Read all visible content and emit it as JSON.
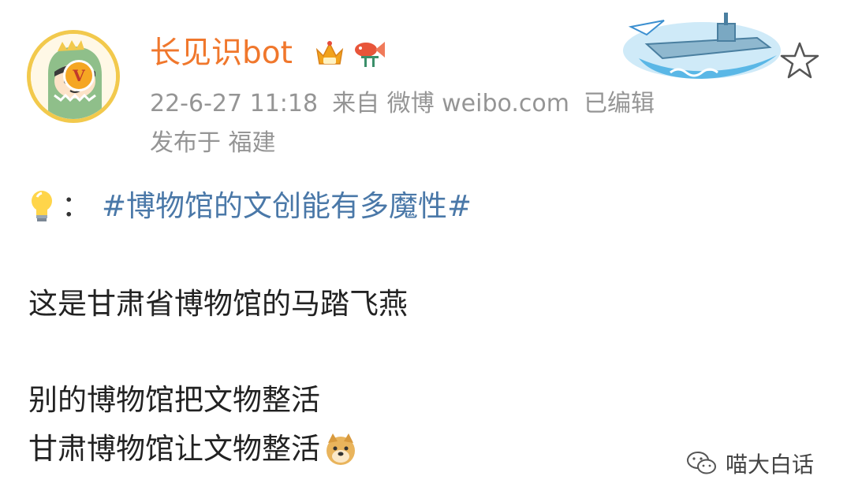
{
  "post": {
    "author": "长见识bot",
    "author_color": "#f0772c",
    "timestamp": "22-6-27 11:18",
    "source": "来自 微博 weibo.com",
    "edited": "已编辑",
    "location": "发布于 福建",
    "topic_emoji": "lightbulb-icon",
    "colon": "：",
    "hashtag": "#博物馆的文创能有多魔性#",
    "hashtag_color": "#4a78a8",
    "lines": [
      "这是甘肃省博物馆的马踏飞燕",
      "别的博物馆把文物整活",
      "甘肃博物馆让文物整活"
    ],
    "end_emoji": "doge-icon",
    "verified_badge": "V"
  },
  "watermark": {
    "text": "喵大白话",
    "icon": "wechat-icon"
  }
}
